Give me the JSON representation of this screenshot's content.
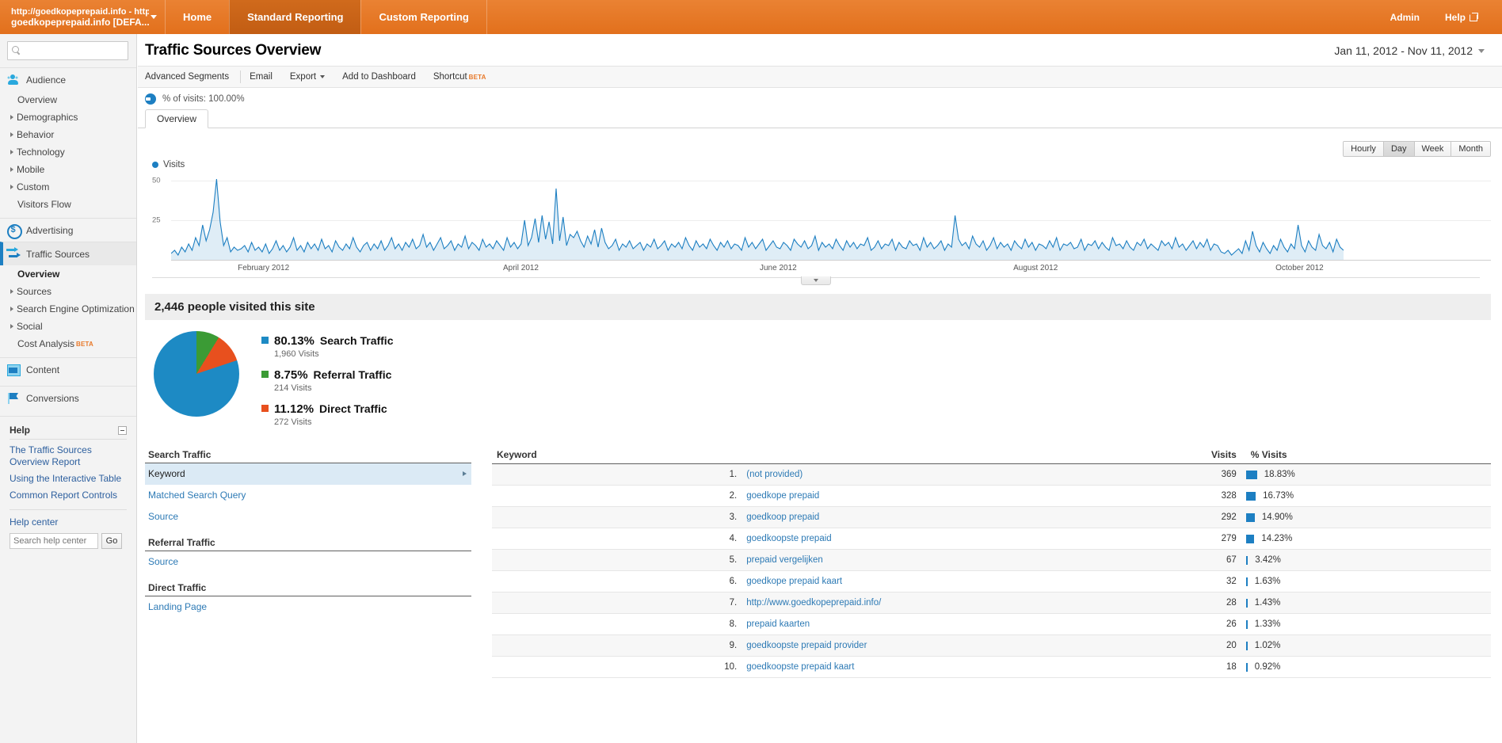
{
  "topbar": {
    "account_line1": "http://goedkopeprepaid.info - http:...",
    "account_line2": "goedkopeprepaid.info [DEFA...",
    "nav": [
      {
        "label": "Home",
        "active": false
      },
      {
        "label": "Standard Reporting",
        "active": true
      },
      {
        "label": "Custom Reporting",
        "active": false
      }
    ],
    "admin_label": "Admin",
    "help_label": "Help"
  },
  "sidebar": {
    "search_placeholder": "",
    "sections": [
      {
        "label": "Audience",
        "icon": "audience-icon",
        "active": false,
        "items": [
          {
            "label": "Overview",
            "arrow": false,
            "current": false
          },
          {
            "label": "Demographics",
            "arrow": true,
            "current": false
          },
          {
            "label": "Behavior",
            "arrow": true,
            "current": false
          },
          {
            "label": "Technology",
            "arrow": true,
            "current": false
          },
          {
            "label": "Mobile",
            "arrow": true,
            "current": false
          },
          {
            "label": "Custom",
            "arrow": true,
            "current": false
          },
          {
            "label": "Visitors Flow",
            "arrow": false,
            "current": false
          }
        ]
      },
      {
        "label": "Advertising",
        "icon": "advertising-icon",
        "active": false,
        "items": []
      },
      {
        "label": "Traffic Sources",
        "icon": "traffic-sources-icon",
        "active": true,
        "items": [
          {
            "label": "Overview",
            "arrow": false,
            "current": true
          },
          {
            "label": "Sources",
            "arrow": true,
            "current": false
          },
          {
            "label": "Search Engine Optimization",
            "arrow": true,
            "current": false
          },
          {
            "label": "Social",
            "arrow": true,
            "current": false
          },
          {
            "label": "Cost Analysis",
            "arrow": false,
            "current": false,
            "badge": "BETA"
          }
        ]
      },
      {
        "label": "Content",
        "icon": "content-icon",
        "active": false,
        "items": []
      },
      {
        "label": "Conversions",
        "icon": "conversions-icon",
        "active": false,
        "items": []
      }
    ],
    "help": {
      "title": "Help",
      "links": [
        "The Traffic Sources Overview Report",
        "Using the Interactive Table",
        "Common Report Controls"
      ],
      "center_label": "Help center",
      "search_placeholder": "Search help center",
      "go_label": "Go"
    }
  },
  "page": {
    "title": "Traffic Sources Overview",
    "date_range": "Jan 11, 2012 - Nov 11, 2012",
    "toolbar": [
      {
        "label": "Advanced Segments",
        "caret": false
      },
      {
        "label": "Email",
        "caret": false
      },
      {
        "label": "Export",
        "caret": true
      },
      {
        "label": "Add to Dashboard",
        "caret": false
      },
      {
        "label": "Shortcut",
        "caret": false,
        "badge": "BETA"
      }
    ],
    "segment_label": "% of visits: 100.00%",
    "report_tabs": [
      {
        "label": "Overview",
        "active": true
      }
    ],
    "granularity": [
      {
        "label": "Hourly",
        "on": false
      },
      {
        "label": "Day",
        "on": true
      },
      {
        "label": "Week",
        "on": false
      },
      {
        "label": "Month",
        "on": false
      }
    ]
  },
  "chart_data": {
    "type": "area",
    "title": "",
    "legend": [
      "Visits"
    ],
    "legend_position": "top-left",
    "xlabel": "",
    "ylabel": "",
    "ylim": [
      0,
      55
    ],
    "yticks": [
      25,
      50
    ],
    "grid": true,
    "series_color": "#1d7fc2",
    "xticks": [
      "February 2012",
      "April 2012",
      "June 2012",
      "August 2012",
      "October 2012"
    ],
    "xtick_positions_pct": [
      7.0,
      26.5,
      46.0,
      65.5,
      85.5
    ],
    "x_start": "Jan 11, 2012",
    "x_end": "Nov 11, 2012",
    "series": [
      {
        "name": "Visits",
        "values": [
          4,
          6,
          3,
          8,
          5,
          10,
          6,
          14,
          9,
          22,
          12,
          19,
          30,
          51,
          24,
          9,
          14,
          5,
          8,
          6,
          7,
          9,
          5,
          11,
          6,
          8,
          5,
          10,
          4,
          7,
          12,
          6,
          9,
          5,
          8,
          14,
          6,
          9,
          5,
          11,
          7,
          10,
          6,
          13,
          7,
          9,
          5,
          12,
          8,
          6,
          10,
          7,
          14,
          8,
          5,
          9,
          11,
          6,
          10,
          7,
          12,
          6,
          9,
          14,
          7,
          10,
          6,
          11,
          8,
          13,
          7,
          9,
          16,
          8,
          11,
          6,
          10,
          14,
          7,
          9,
          12,
          6,
          10,
          8,
          15,
          7,
          11,
          9,
          6,
          13,
          8,
          10,
          7,
          12,
          9,
          6,
          14,
          8,
          11,
          7,
          10,
          25,
          9,
          14,
          26,
          11,
          28,
          13,
          24,
          10,
          45,
          12,
          27,
          9,
          16,
          14,
          18,
          12,
          8,
          15,
          10,
          19,
          8,
          20,
          11,
          7,
          9,
          13,
          6,
          10,
          8,
          12,
          7,
          9,
          11,
          6,
          10,
          8,
          13,
          7,
          9,
          12,
          6,
          10,
          8,
          11,
          7,
          14,
          9,
          6,
          12,
          8,
          10,
          7,
          13,
          9,
          6,
          11,
          8,
          12,
          7,
          10,
          9,
          6,
          14,
          8,
          11,
          7,
          10,
          13,
          6,
          9,
          12,
          8,
          7,
          11,
          9,
          6,
          13,
          10,
          8,
          12,
          7,
          9,
          15,
          6,
          11,
          8,
          10,
          7,
          13,
          9,
          6,
          12,
          8,
          11,
          7,
          10,
          9,
          14,
          6,
          8,
          12,
          7,
          10,
          9,
          13,
          6,
          11,
          8,
          7,
          12,
          9,
          10,
          6,
          14,
          8,
          11,
          7,
          9,
          12,
          6,
          10,
          8,
          28,
          13,
          9,
          11,
          7,
          15,
          10,
          8,
          12,
          6,
          9,
          14,
          7,
          11,
          8,
          10,
          6,
          12,
          9,
          7,
          13,
          8,
          11,
          6,
          10,
          9,
          7,
          12,
          8,
          14,
          6,
          10,
          9,
          11,
          7,
          8,
          13,
          6,
          10,
          9,
          12,
          7,
          11,
          8,
          6,
          14,
          9,
          10,
          7,
          12,
          8,
          6,
          11,
          9,
          13,
          7,
          10,
          8,
          6,
          12,
          9,
          11,
          7,
          14,
          8,
          10,
          6,
          9,
          12,
          7,
          11,
          8,
          13,
          6,
          10,
          9,
          5,
          4,
          6,
          3,
          5,
          7,
          4,
          12,
          6,
          18,
          9,
          5,
          11,
          7,
          4,
          9,
          6,
          13,
          8,
          5,
          10,
          7,
          22,
          9,
          5,
          12,
          8,
          6,
          16,
          9,
          7,
          11,
          5,
          13,
          8,
          6
        ]
      }
    ]
  },
  "visitors": {
    "headline": "2,446 people visited this site",
    "pie": {
      "type": "pie",
      "slices": [
        {
          "label": "Search Traffic",
          "pct": "80.13%",
          "value": 80.13,
          "visits_label": "1,960 Visits",
          "visits": 1960,
          "color": "#1d8ac4"
        },
        {
          "label": "Referral Traffic",
          "pct": "8.75%",
          "value": 8.75,
          "visits_label": "214 Visits",
          "visits": 214,
          "color": "#3b9b35"
        },
        {
          "label": "Direct Traffic",
          "pct": "11.12%",
          "value": 11.12,
          "visits_label": "272 Visits",
          "visits": 272,
          "color": "#e8501e"
        }
      ]
    }
  },
  "dimension_groups": [
    {
      "title": "Search Traffic",
      "items": [
        {
          "label": "Keyword",
          "selected": true
        },
        {
          "label": "Matched Search Query",
          "selected": false
        },
        {
          "label": "Source",
          "selected": false
        }
      ]
    },
    {
      "title": "Referral Traffic",
      "items": [
        {
          "label": "Source",
          "selected": false
        }
      ]
    },
    {
      "title": "Direct Traffic",
      "items": [
        {
          "label": "Landing Page",
          "selected": false
        }
      ]
    }
  ],
  "keyword_table": {
    "columns": [
      "Keyword",
      "Visits",
      "% Visits"
    ],
    "rows": [
      {
        "rank": "1.",
        "keyword": "(not provided)",
        "visits": "369",
        "pct": "18.83%",
        "pct_value": 18.83
      },
      {
        "rank": "2.",
        "keyword": "goedkope prepaid",
        "visits": "328",
        "pct": "16.73%",
        "pct_value": 16.73
      },
      {
        "rank": "3.",
        "keyword": "goedkoop prepaid",
        "visits": "292",
        "pct": "14.90%",
        "pct_value": 14.9
      },
      {
        "rank": "4.",
        "keyword": "goedkoopste prepaid",
        "visits": "279",
        "pct": "14.23%",
        "pct_value": 14.23
      },
      {
        "rank": "5.",
        "keyword": "prepaid vergelijken",
        "visits": "67",
        "pct": "3.42%",
        "pct_value": 3.42
      },
      {
        "rank": "6.",
        "keyword": "goedkope prepaid kaart",
        "visits": "32",
        "pct": "1.63%",
        "pct_value": 1.63
      },
      {
        "rank": "7.",
        "keyword": "http://www.goedkopeprepaid.info/",
        "visits": "28",
        "pct": "1.43%",
        "pct_value": 1.43
      },
      {
        "rank": "8.",
        "keyword": "prepaid kaarten",
        "visits": "26",
        "pct": "1.33%",
        "pct_value": 1.33
      },
      {
        "rank": "9.",
        "keyword": "goedkoopste prepaid provider",
        "visits": "20",
        "pct": "1.02%",
        "pct_value": 1.02
      },
      {
        "rank": "10.",
        "keyword": "goedkoopste prepaid kaart",
        "visits": "18",
        "pct": "0.92%",
        "pct_value": 0.92
      }
    ]
  },
  "colors": {
    "brand_orange": "#e8792a",
    "accent_blue": "#1d7fc2",
    "green": "#3b9b35",
    "red_orange": "#e8501e",
    "link_blue": "#2d7ab5"
  }
}
